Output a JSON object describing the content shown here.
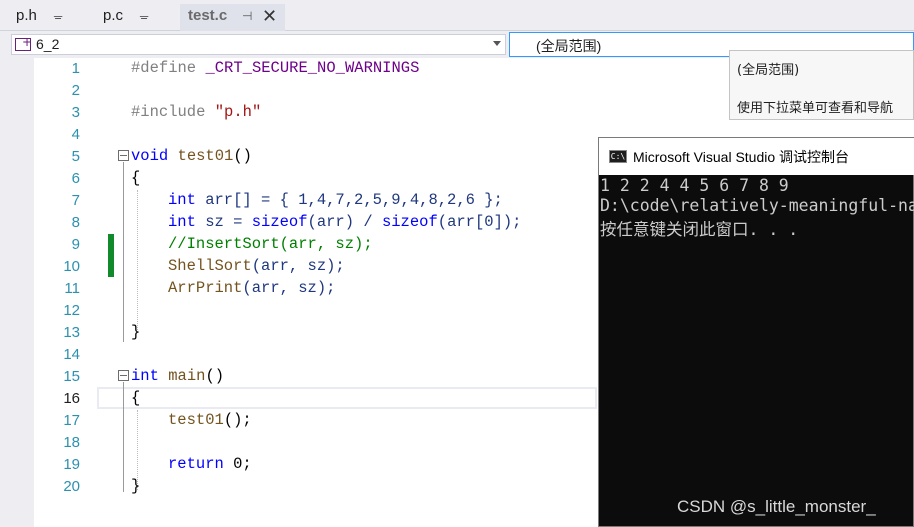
{
  "tabs": [
    {
      "label": "p.h",
      "pin": "ᚚ"
    },
    {
      "label": "p.c",
      "pin": "ᚚ"
    },
    {
      "label": "test.c",
      "pin": "⊣",
      "close": "✕",
      "active": true
    }
  ],
  "nav": {
    "project": "6_2",
    "scope": "(全局范围)"
  },
  "tooltip": {
    "title": "(全局范围)",
    "hint": "使用下拉菜单可查看和导航"
  },
  "code": {
    "line_numbers": [
      "1",
      "2",
      "3",
      "4",
      "5",
      "6",
      "7",
      "8",
      "9",
      "10",
      "11",
      "12",
      "13",
      "14",
      "15",
      "16",
      "17",
      "18",
      "19",
      "20"
    ],
    "define_kw": "#define",
    "define_name": "_CRT_SECURE_NO_WARNINGS",
    "include_kw": "#include",
    "include_file": "\"p.h\"",
    "void_kw": "void",
    "test01_name": "test01",
    "test01_parens": "()",
    "open_brace": "{",
    "close_brace": "}",
    "int_kw": "int",
    "arr_decl": " arr[] = { 1,4,7,2,5,9,4,8,2,6 };",
    "sz_part1": " sz = ",
    "sizeof_kw": "sizeof",
    "sz_part2": "(arr) / ",
    "sz_part3": "(arr[0]);",
    "comment_line": "//InsertSort(arr, sz);",
    "shellsort_name": "ShellSort",
    "shellsort_args": "(arr, sz);",
    "arrprint_name": "ArrPrint",
    "arrprint_args": "(arr, sz);",
    "main_name": "main",
    "main_parens": "()",
    "call_test01": "test01",
    "call_test01_args": "();",
    "return_kw": "return",
    "return_val": " 0;"
  },
  "console": {
    "title": "Microsoft Visual Studio 调试控制台",
    "icon_text": "C:\\",
    "lines": [
      "1 2 2 4 4 5 6 7 8 9",
      "D:\\code\\relatively-meaningful-na",
      "按任意键关闭此窗口. . ."
    ]
  },
  "watermark": "CSDN @s_little_monster_",
  "colors": {
    "keyword": "#0000ff",
    "string": "#a31515",
    "macro": "#6f008a",
    "function": "#74531f",
    "comment": "#008000",
    "line_number": "#2b91af",
    "change_marker": "#108a2a"
  }
}
